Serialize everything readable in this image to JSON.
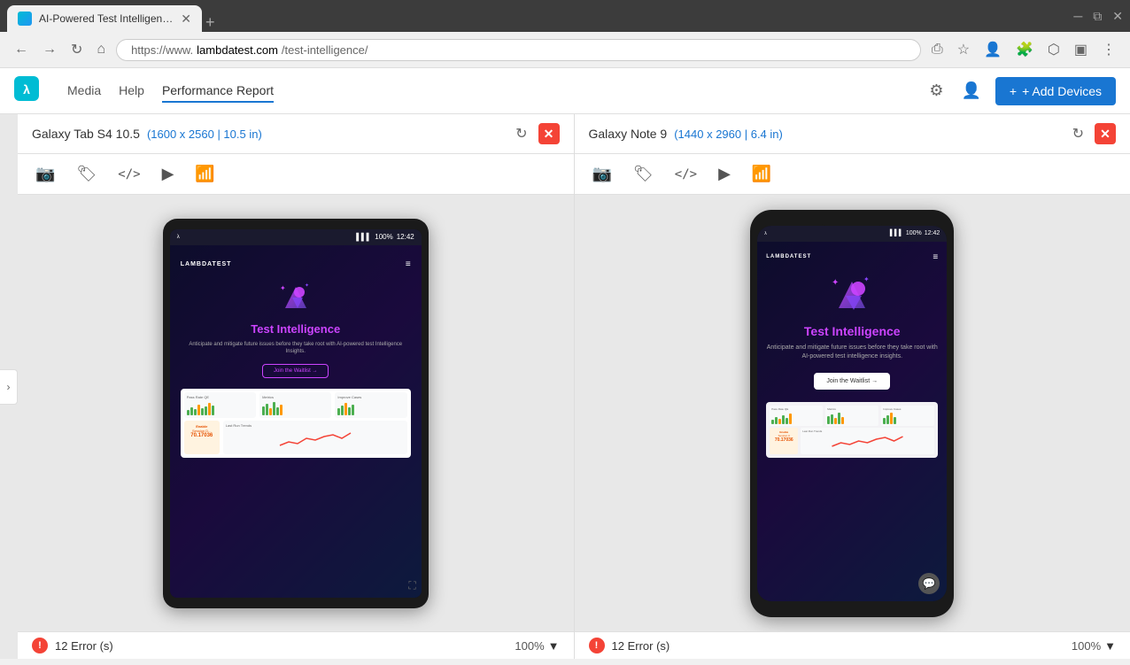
{
  "browser": {
    "tab_label": "AI-Powered Test Intelligence Plat...",
    "url_prefix": "https://www.",
    "url_domain": "lambdatest.com",
    "url_path": "/test-intelligence/",
    "new_tab_label": "+"
  },
  "app_header": {
    "nav_items": [
      {
        "id": "media",
        "label": "Media"
      },
      {
        "id": "help",
        "label": "Help"
      },
      {
        "id": "performance",
        "label": "Performance Report"
      }
    ],
    "add_devices_label": "+ Add Devices"
  },
  "devices": [
    {
      "id": "galaxy-tab",
      "name": "Galaxy Tab S4 10.5",
      "specs": "(1600 x 2560 | 10.5 in)",
      "zoom": "100%",
      "error_count": "12 Error (s)",
      "statusbar_time": "12:42",
      "statusbar_battery": "100%"
    },
    {
      "id": "galaxy-note",
      "name": "Galaxy Note 9",
      "specs": "(1440 x 2960 | 6.4 in)",
      "zoom": "100%",
      "error_count": "12 Error (s)",
      "statusbar_time": "12:42",
      "statusbar_battery": "100%"
    }
  ],
  "site_content": {
    "logo_text": "LAMBDATEST",
    "title": "Test Intelligence",
    "subtitle": "Anticipate and mitigate future issues before they take root with AI-powered test Intelligence Insights.",
    "cta_label": "Join the Waitlist →",
    "phone_subtitle": "Anticipate and mitigate future issues before they take root with AI-powered test intelligence insights."
  },
  "icons": {
    "screenshot": "📷",
    "tag": "🏷",
    "code": "</>",
    "video": "▶",
    "network": "📶",
    "rotate": "↻",
    "close": "✕",
    "collapse": "›",
    "settings": "⚙",
    "profile": "👤",
    "chat": "💬"
  }
}
